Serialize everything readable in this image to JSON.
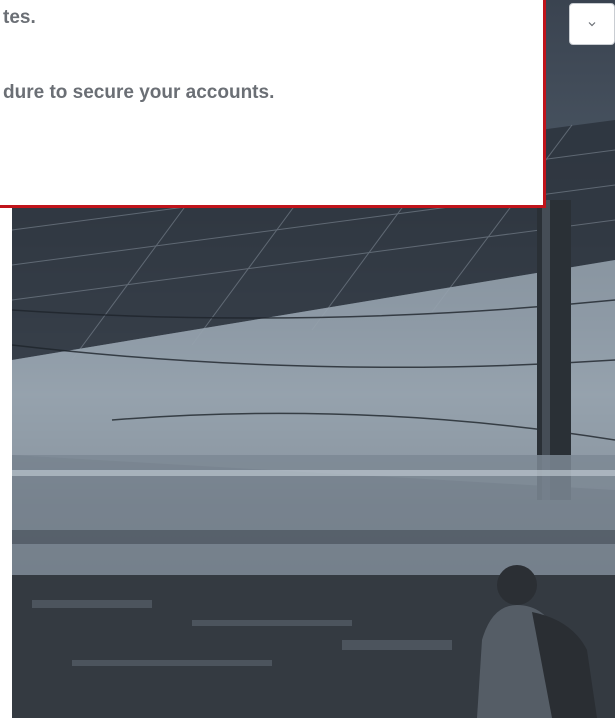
{
  "notice": {
    "line1": "tes.",
    "line2": "dure to secure your accounts."
  },
  "dropdown": {
    "icon": "chevron-down-icon"
  },
  "hero": {
    "image": "train-station-platform-photo"
  },
  "colors": {
    "notice_border": "#c0141b",
    "notice_text": "#6b6f75"
  }
}
